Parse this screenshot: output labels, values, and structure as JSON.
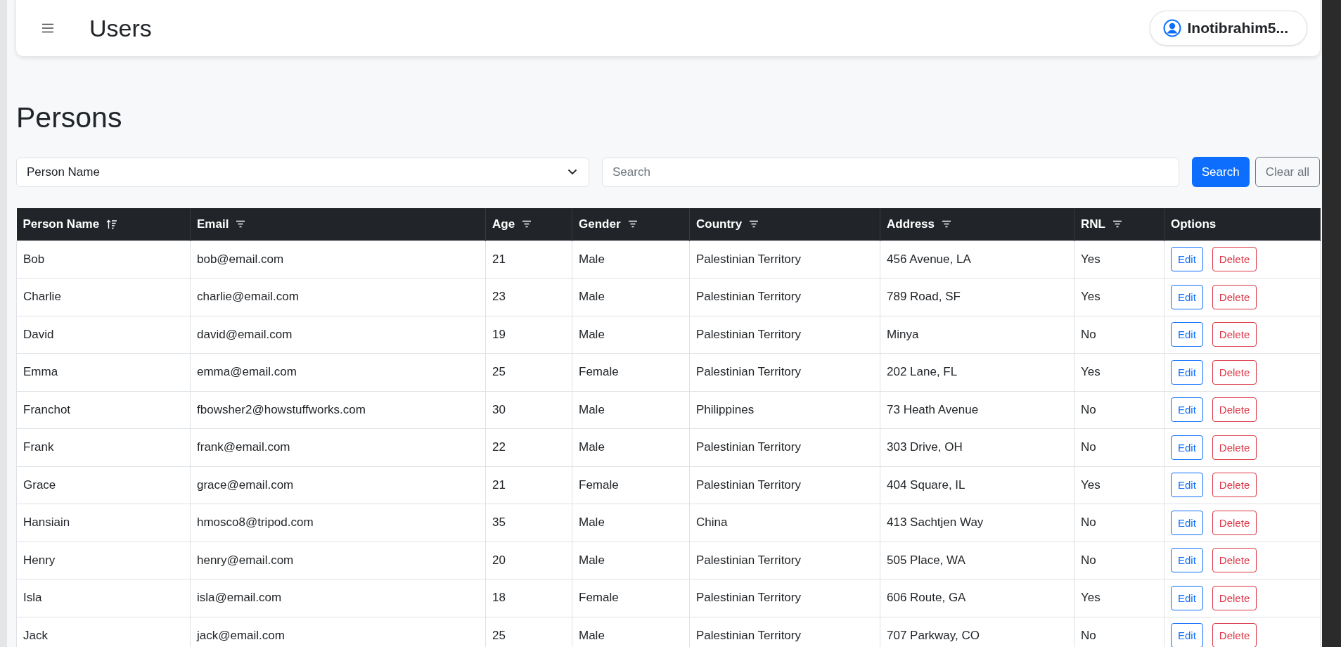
{
  "header": {
    "title": "Users",
    "user": "Inotibrahim5..."
  },
  "page_title": "Persons",
  "filter": {
    "field": "Person Name",
    "search_placeholder": "Search",
    "search_button": "Search",
    "clear_button": "Clear all"
  },
  "table": {
    "columns": [
      {
        "label": "Person Name",
        "kind": "sorted"
      },
      {
        "label": "Email",
        "kind": "filter"
      },
      {
        "label": "Age",
        "kind": "filter"
      },
      {
        "label": "Gender",
        "kind": "filter"
      },
      {
        "label": "Country",
        "kind": "filter"
      },
      {
        "label": "Address",
        "kind": "filter"
      },
      {
        "label": "RNL",
        "kind": "filter"
      },
      {
        "label": "Options",
        "kind": "plain"
      }
    ],
    "rows": [
      {
        "cells": [
          "Bob",
          "bob@email.com",
          "21",
          "Male",
          "Palestinian Territory",
          "456 Avenue, LA",
          "Yes"
        ],
        "edit": "Edit",
        "delete": "Delete"
      },
      {
        "cells": [
          "Charlie",
          "charlie@email.com",
          "23",
          "Male",
          "Palestinian Territory",
          "789 Road, SF",
          "Yes"
        ],
        "edit": "Edit",
        "delete": "Delete"
      },
      {
        "cells": [
          "David",
          "david@email.com",
          "19",
          "Male",
          "Palestinian Territory",
          "Minya",
          "No"
        ],
        "edit": "Edit",
        "delete": "Delete"
      },
      {
        "cells": [
          "Emma",
          "emma@email.com",
          "25",
          "Female",
          "Palestinian Territory",
          "202 Lane, FL",
          "Yes"
        ],
        "edit": "Edit",
        "delete": "Delete"
      },
      {
        "cells": [
          "Franchot",
          "fbowsher2@howstuffworks.com",
          "30",
          "Male",
          "Philippines",
          "73 Heath Avenue",
          "No"
        ],
        "edit": "Edit",
        "delete": "Delete"
      },
      {
        "cells": [
          "Frank",
          "frank@email.com",
          "22",
          "Male",
          "Palestinian Territory",
          "303 Drive, OH",
          "No"
        ],
        "edit": "Edit",
        "delete": "Delete"
      },
      {
        "cells": [
          "Grace",
          "grace@email.com",
          "21",
          "Female",
          "Palestinian Territory",
          "404 Square, IL",
          "Yes"
        ],
        "edit": "Edit",
        "delete": "Delete"
      },
      {
        "cells": [
          "Hansiain",
          "hmosco8@tripod.com",
          "35",
          "Male",
          "China",
          "413 Sachtjen Way",
          "No"
        ],
        "edit": "Edit",
        "delete": "Delete"
      },
      {
        "cells": [
          "Henry",
          "henry@email.com",
          "20",
          "Male",
          "Palestinian Territory",
          "505 Place, WA",
          "No"
        ],
        "edit": "Edit",
        "delete": "Delete"
      },
      {
        "cells": [
          "Isla",
          "isla@email.com",
          "18",
          "Female",
          "Palestinian Territory",
          "606 Route, GA",
          "Yes"
        ],
        "edit": "Edit",
        "delete": "Delete"
      },
      {
        "cells": [
          "Jack",
          "jack@email.com",
          "25",
          "Male",
          "Palestinian Territory",
          "707 Parkway, CO",
          "No"
        ],
        "edit": "Edit",
        "delete": "Delete"
      }
    ]
  }
}
